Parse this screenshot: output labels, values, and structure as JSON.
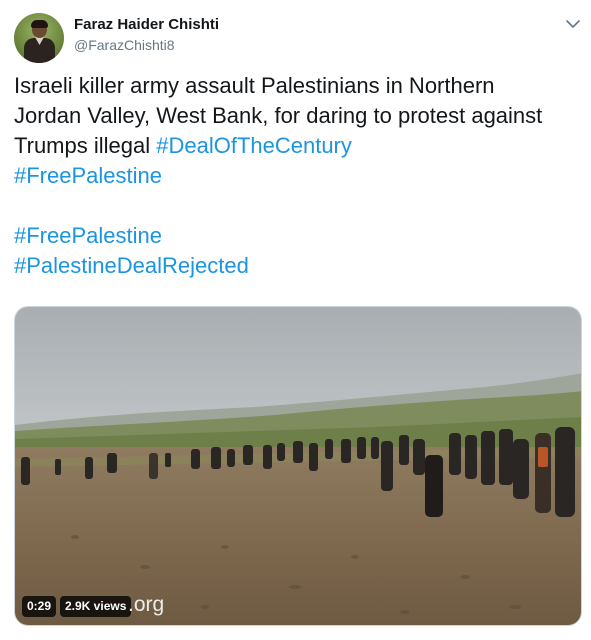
{
  "author": {
    "name": "Faraz Haider Chishti",
    "handle": "@FarazChishti8"
  },
  "tweet": {
    "lines": [
      [
        {
          "text": "Israeli killer army assault Palestinians in Northern",
          "type": "text"
        }
      ],
      [
        {
          "text": "Jordan Valley, West Bank, for daring to protest against",
          "type": "text"
        }
      ],
      [
        {
          "text": "Trumps illegal ",
          "type": "text"
        },
        {
          "text": "#DealOfTheCentury",
          "type": "hashtag"
        }
      ],
      [
        {
          "text": "#FreePalestine",
          "type": "hashtag"
        }
      ],
      [],
      [
        {
          "text": "#FreePalestine",
          "type": "hashtag"
        }
      ],
      [
        {
          "text": "#PalestineDealRejected",
          "type": "hashtag"
        }
      ]
    ]
  },
  "video": {
    "duration": "0:29",
    "views": "2.9K views",
    "watermark": ".org"
  },
  "icons": {
    "menu": "chevron-down-icon"
  },
  "colors": {
    "hashtag": "#1b95e0",
    "text": "#14171a",
    "secondary": "#657786"
  }
}
